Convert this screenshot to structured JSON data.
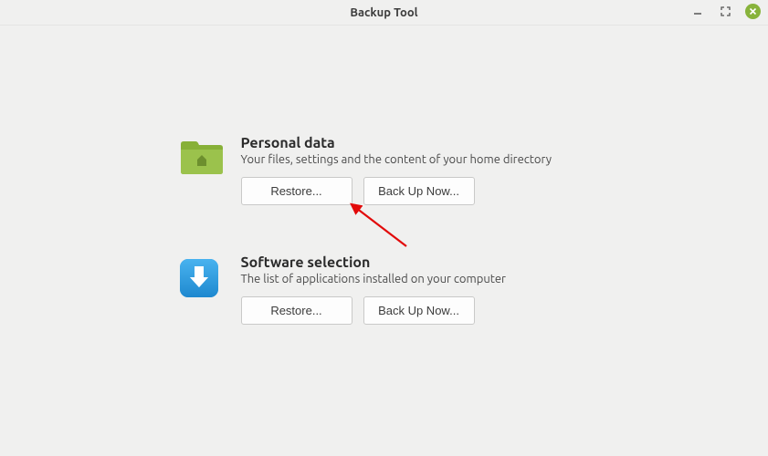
{
  "window": {
    "title": "Backup Tool"
  },
  "sections": {
    "personal": {
      "title": "Personal data",
      "desc": "Your files, settings and the content of your home directory",
      "restore": "Restore...",
      "backup": "Back Up Now..."
    },
    "software": {
      "title": "Software selection",
      "desc": "The list of applications installed on your computer",
      "restore": "Restore...",
      "backup": "Back Up Now..."
    }
  }
}
